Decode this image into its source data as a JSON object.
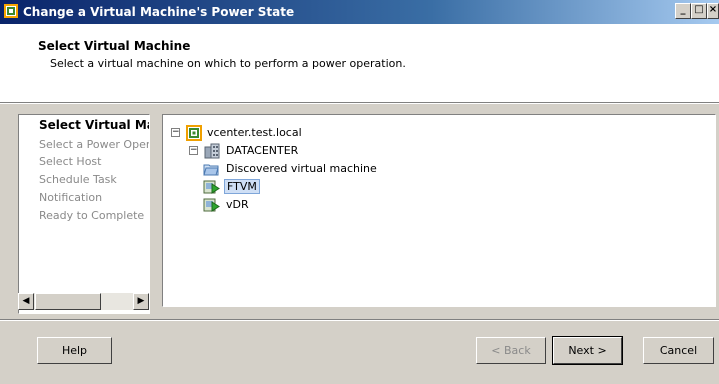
{
  "window": {
    "title": "Change a Virtual Machine's Power State",
    "controls": [
      "minimize",
      "maximize",
      "close"
    ]
  },
  "header": {
    "title": "Select Virtual Machine",
    "subtitle": "Select a virtual machine on which to perform a power operation."
  },
  "steps": {
    "items": [
      {
        "label": "Select Virtual Machine",
        "current": true
      },
      {
        "label": "Select a Power Operation",
        "current": false
      },
      {
        "label": "Select Host",
        "current": false
      },
      {
        "label": "Schedule Task",
        "current": false
      },
      {
        "label": "Notification",
        "current": false
      },
      {
        "label": "Ready to Complete",
        "current": false
      }
    ]
  },
  "tree": {
    "vcenter": {
      "label": "vcenter.test.local",
      "icon": "vcenter-icon",
      "expanded": true
    },
    "datacenter": {
      "label": "DATACENTER",
      "icon": "datacenter-icon",
      "expanded": true
    },
    "folder": {
      "label": "Discovered virtual machine",
      "icon": "folder-icon"
    },
    "vm1": {
      "label": "FTVM",
      "icon": "vm-icon",
      "selected": true
    },
    "vm2": {
      "label": "vDR",
      "icon": "vm-icon",
      "selected": false
    }
  },
  "buttons": {
    "help": "Help",
    "back": "< Back",
    "next": "Next >",
    "cancel": "Cancel"
  },
  "colors": {
    "titlebar_start": "#0a246a",
    "titlebar_end": "#a6caf0",
    "selection": "#cfdff5"
  }
}
